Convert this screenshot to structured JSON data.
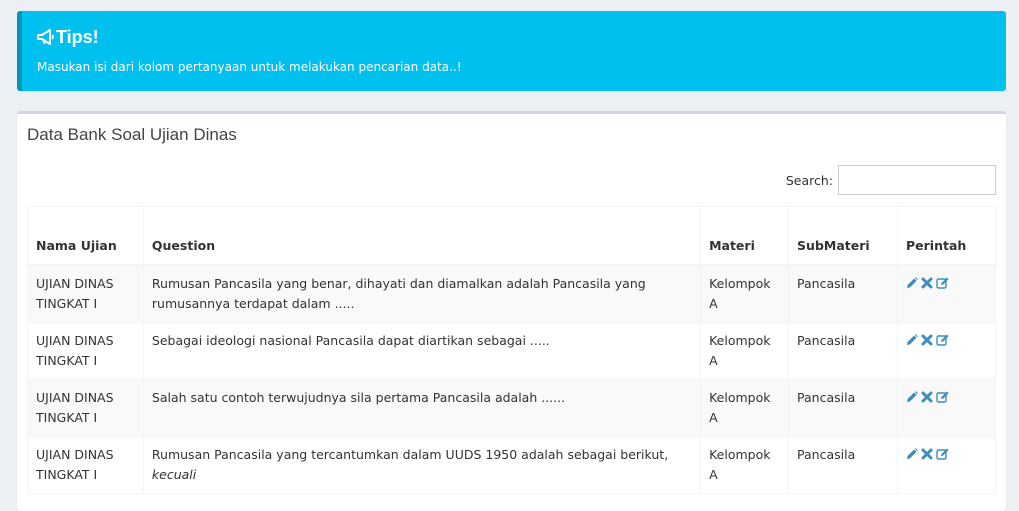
{
  "callout": {
    "icon": "bullhorn-icon",
    "title": "Tips!",
    "message": "Masukan isi dari kolom pertanyaan untuk melakukan pencarian data..!",
    "color": "#00c0ef"
  },
  "box": {
    "title": "Data Bank Soal Ujian Dinas",
    "search_label": "Search:",
    "search_value": ""
  },
  "table": {
    "headers": [
      "Nama Ujian",
      "Question",
      "Materi",
      "SubMateri",
      "Perintah"
    ],
    "rows": [
      {
        "nama": "UJIAN DINAS TINGKAT I",
        "question": "Rumusan Pancasila yang benar, dihayati dan diamalkan adalah Pancasila yang rumusannya terdapat dalam .....",
        "materi": "Kelompok A",
        "submateri": "Pancasila"
      },
      {
        "nama": "UJIAN DINAS TINGKAT I",
        "question": "Sebagai ideologi nasional Pancasila dapat diartikan sebagai .....",
        "materi": "Kelompok A",
        "submateri": "Pancasila"
      },
      {
        "nama": "UJIAN DINAS TINGKAT I",
        "question": "Salah satu contoh terwujudnya sila pertama Pancasila adalah ......",
        "materi": "Kelompok A",
        "submateri": "Pancasila"
      },
      {
        "nama": "UJIAN DINAS TINGKAT I",
        "question": "Rumusan Pancasila yang tercantumkan dalam UUDS 1950 adalah sebagai berikut,",
        "question_em": "kecuali",
        "materi": "Kelompok A",
        "submateri": "Pancasila"
      }
    ],
    "action_icons": [
      "pencil-icon",
      "delete-icon",
      "edit-square-icon"
    ],
    "action_color": "#3c8dbc"
  }
}
